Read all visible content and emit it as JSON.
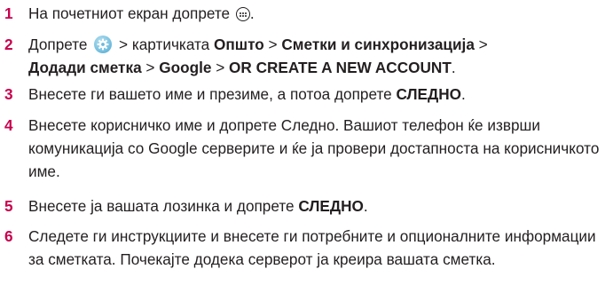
{
  "steps": [
    {
      "num": "1",
      "a": "На почетниот екран допрете",
      "icon": "apps-icon",
      "b": "."
    },
    {
      "num": "2",
      "a": "Допрете",
      "icon": "settings-gear-icon",
      "b": " > картичката ",
      "c": "Општо",
      "d": " > ",
      "e": "Сметки и синхронизација",
      "f": " > ",
      "g": "Додади сметка",
      "h": " > ",
      "i": "Google",
      "j": " > ",
      "k": "OR CREATE A NEW ACCOUNT",
      "l": "."
    },
    {
      "num": "3",
      "a": "Внесете ги вашето име и презиме, а потоа допрете ",
      "b": "СЛЕДНО",
      "c": "."
    },
    {
      "num": "4",
      "a": "Внесете корисничко име и допрете Следно. Вашиот телефон ќе изврши комуникација со Google серверите и ќе ја провери достапноста на корисничкото име."
    },
    {
      "num": "5",
      "a": "Внесете ја вашата лозинка и допрете ",
      "b": "СЛЕДНО",
      "c": "."
    },
    {
      "num": "6",
      "a": "Следете ги инструкциите и внесете ги потребните и опционалните информации за сметката. Почекајте додека серверот ја креира вашата сметка."
    }
  ]
}
